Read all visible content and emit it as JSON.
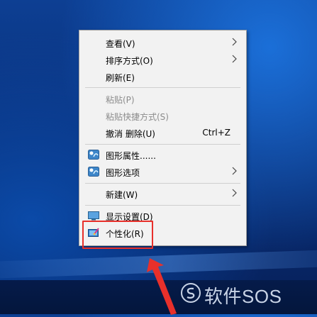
{
  "context_menu": {
    "items": [
      {
        "label": "查看(V)",
        "has_submenu": true
      },
      {
        "label": "排序方式(O)",
        "has_submenu": true
      },
      {
        "label": "刷新(E)"
      },
      {
        "label": "粘贴(P)",
        "disabled": true
      },
      {
        "label": "粘贴快捷方式(S)",
        "disabled": true
      },
      {
        "label": "撤消 删除(U)",
        "shortcut": "Ctrl+Z"
      },
      {
        "label": "图形属性......",
        "icon": "intel-graphics-icon"
      },
      {
        "label": "图形选项",
        "icon": "intel-graphics-icon",
        "has_submenu": true
      },
      {
        "label": "新建(W)",
        "has_submenu": true
      },
      {
        "label": "显示设置(D)",
        "icon": "display-icon"
      },
      {
        "label": "个性化(R)",
        "icon": "personalize-icon"
      }
    ]
  },
  "annotation": {
    "highlight_color": "#e8302b"
  },
  "watermark": {
    "text": "软件SOS"
  },
  "colors": {
    "menu_bg": "#f2f2f2",
    "desktop": "#0a2f78"
  }
}
